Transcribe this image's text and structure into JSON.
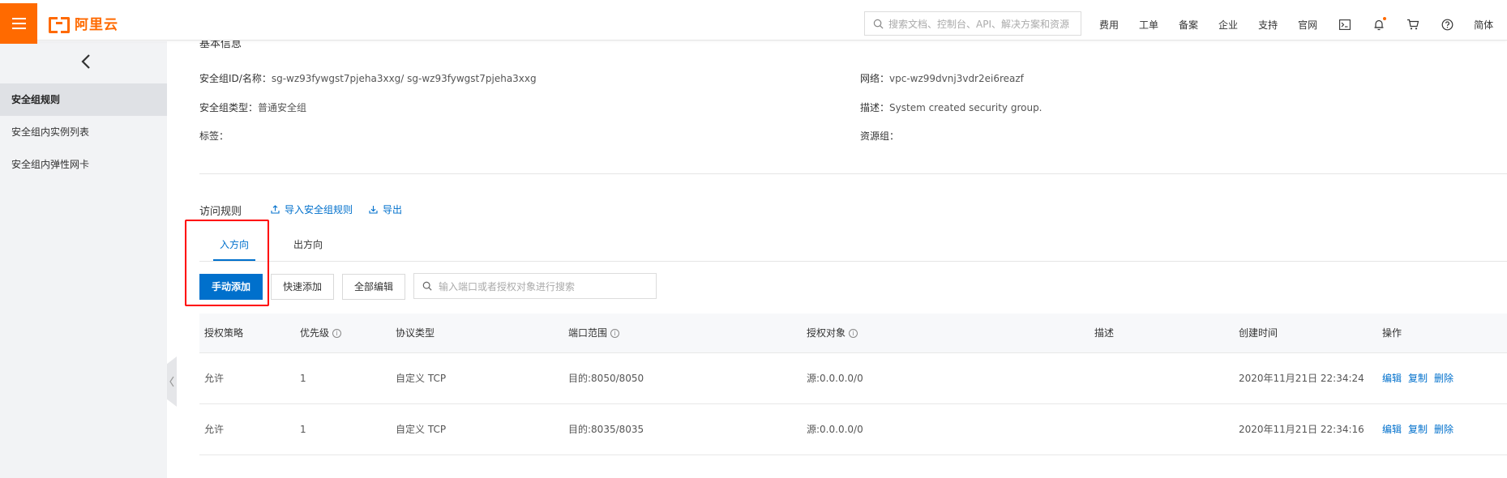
{
  "header": {
    "logo_text": "阿里云",
    "search_placeholder": "搜索文档、控制台、API、解决方案和资源",
    "nav": [
      "费用",
      "工单",
      "备案",
      "企业",
      "支持",
      "官网"
    ],
    "lang": "简体",
    "icons": [
      "terminal-icon",
      "bell-icon",
      "cart-icon",
      "help-icon"
    ],
    "accent": "#ff6a00"
  },
  "sidebar": {
    "items": [
      {
        "label": "安全组规则",
        "active": true
      },
      {
        "label": "安全组内实例列表",
        "active": false
      },
      {
        "label": "安全组内弹性网卡",
        "active": false
      }
    ]
  },
  "basic_info": {
    "title": "基本信息",
    "id_label": "安全组ID/名称：",
    "id_value": "sg-wz93fywgst7pjeha3xxg/ sg-wz93fywgst7pjeha3xxg",
    "type_label": "安全组类型：",
    "type_value": "普通安全组",
    "tags_label": "标签：",
    "network_label": "网络：",
    "network_value": "vpc-wz99dvnj3vdr2ei6reazf",
    "desc_label": "描述：",
    "desc_value": "System created security group.",
    "resource_group_label": "资源组："
  },
  "rules": {
    "title": "访问规则",
    "import_label": "导入安全组规则",
    "export_label": "导出",
    "tabs": [
      {
        "label": "入方向",
        "active": true
      },
      {
        "label": "出方向",
        "active": false
      }
    ],
    "buttons": {
      "manual_add": "手动添加",
      "quick_add": "快速添加",
      "edit_all": "全部编辑"
    },
    "search_placeholder": "输入端口或者授权对象进行搜索",
    "columns": [
      "授权策略",
      "优先级",
      "协议类型",
      "端口范围",
      "授权对象",
      "描述",
      "创建时间",
      "操作"
    ],
    "rows": [
      {
        "policy": "允许",
        "priority": "1",
        "protocol": "自定义 TCP",
        "port": "目的:8050/8050",
        "source": "源:0.0.0.0/0",
        "desc": "",
        "created": "2020年11月21日 22:34:24"
      },
      {
        "policy": "允许",
        "priority": "1",
        "protocol": "自定义 TCP",
        "port": "目的:8035/8035",
        "source": "源:0.0.0.0/0",
        "desc": "",
        "created": "2020年11月21日 22:34:16"
      }
    ],
    "actions": [
      "编辑",
      "复制",
      "删除"
    ],
    "primary_color": "#0070cc"
  }
}
